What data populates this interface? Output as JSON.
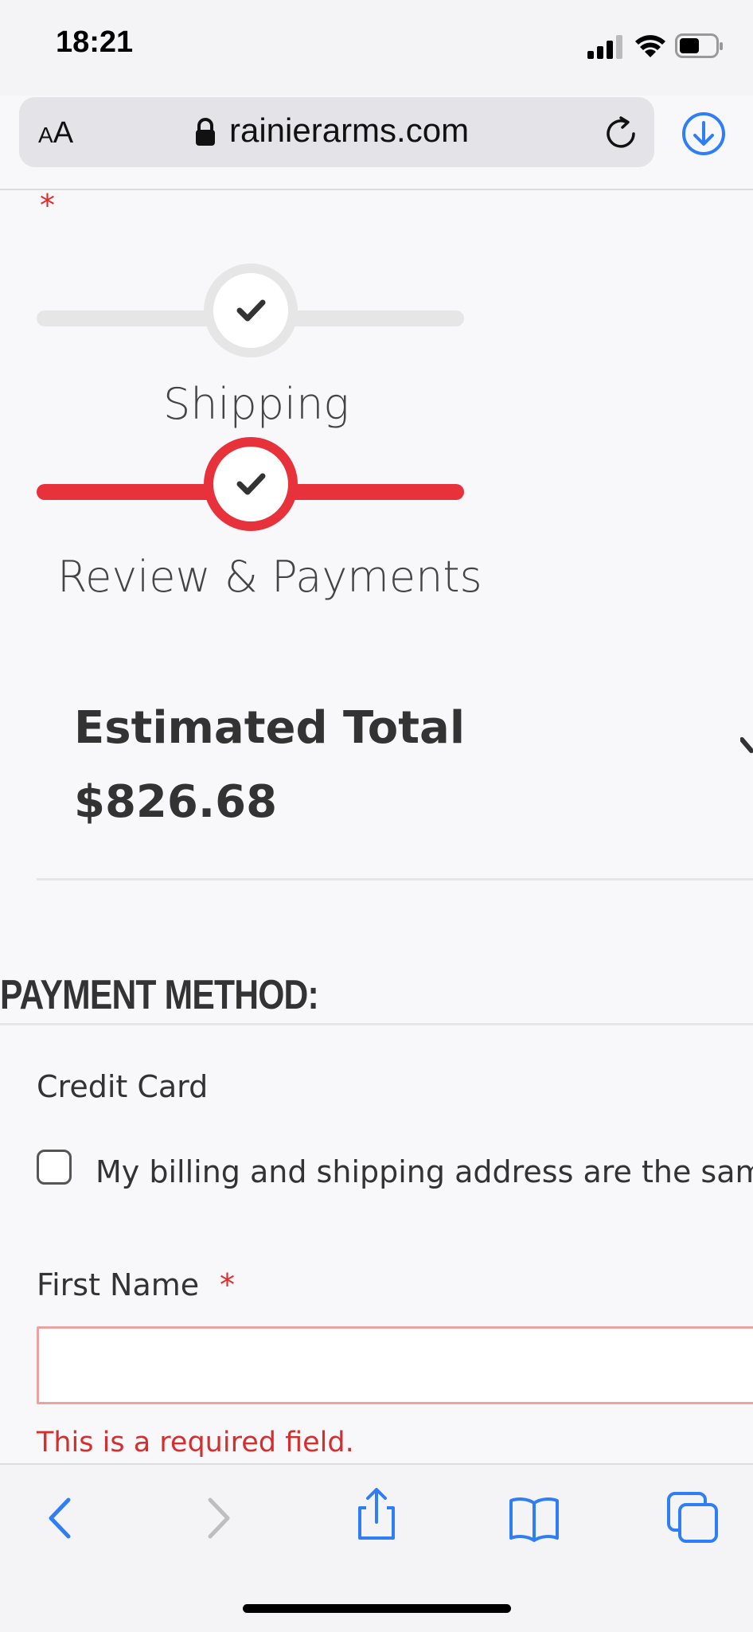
{
  "status_bar": {
    "time": "18:21"
  },
  "browser": {
    "text_size_small": "A",
    "text_size_large": "A",
    "domain": "rainierarms.com"
  },
  "checkout": {
    "required_marker": "*",
    "steps": [
      {
        "label": "Shipping",
        "state": "completed"
      },
      {
        "label": "Review & Payments",
        "state": "active"
      }
    ],
    "estimated_total_label": "Estimated Total",
    "estimated_total_value": "$826.68"
  },
  "payment": {
    "section_title": "PAYMENT METHOD:",
    "method_label": "Credit Card",
    "same_address_label": "My billing and shipping address are the same",
    "same_address_checked": false,
    "first_name_label": "First Name",
    "first_name_required_marker": "*",
    "first_name_value": "",
    "first_name_error": "This is a required field."
  },
  "colors": {
    "accent_red": "#e7323b",
    "error_red": "#d32f2f",
    "ios_blue": "#2f7ef6"
  },
  "icons": {
    "lock": "lock-icon",
    "reload": "reload-icon",
    "download": "download-icon",
    "back": "back-chevron-icon",
    "forward": "forward-chevron-icon",
    "share": "share-icon",
    "bookmarks": "bookmarks-icon",
    "tabs": "tabs-icon"
  }
}
